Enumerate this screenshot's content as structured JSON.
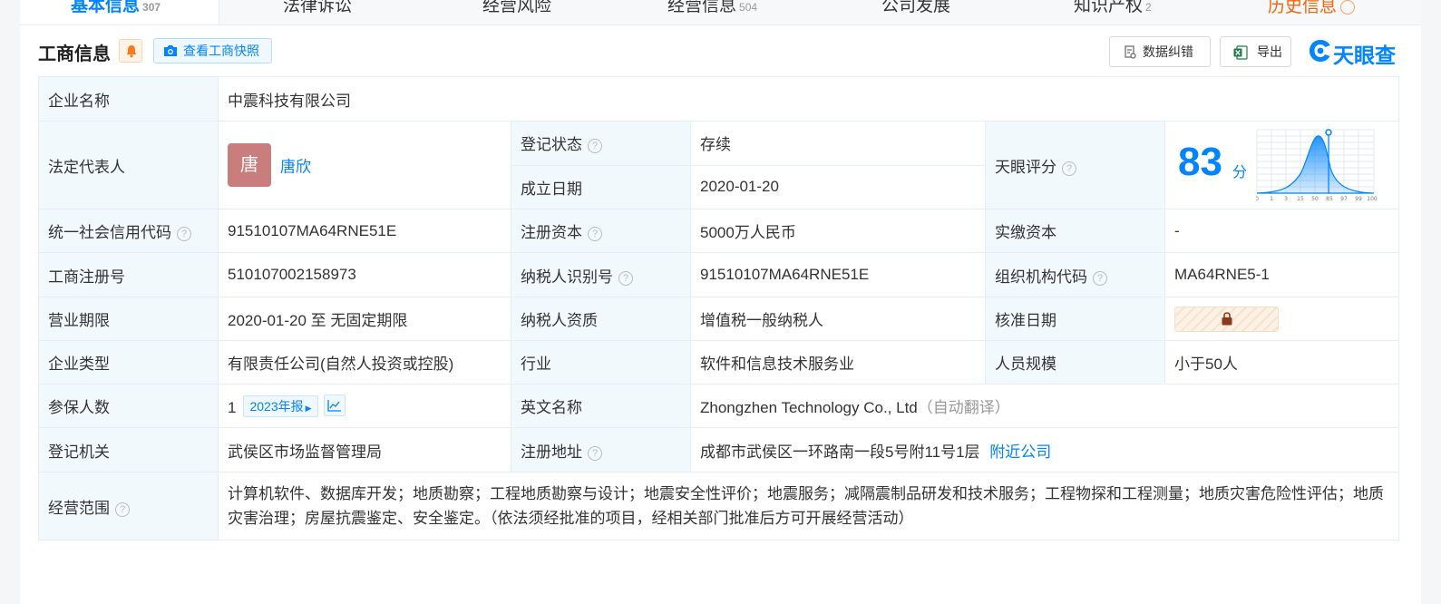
{
  "tabs": [
    {
      "label": "基本信息",
      "count": "307",
      "active": true
    },
    {
      "label": "法律诉讼",
      "count": ""
    },
    {
      "label": "经营风险",
      "count": ""
    },
    {
      "label": "经营信息",
      "count": "504"
    },
    {
      "label": "公司发展",
      "count": ""
    },
    {
      "label": "知识产权",
      "count": "2"
    },
    {
      "label": "历史信息",
      "count": ""
    }
  ],
  "header": {
    "title": "工商信息",
    "snapshot_label": "查看工商快照",
    "feedback_label": "数据纠错",
    "export_label": "导出",
    "logo_text": "天眼查"
  },
  "info": {
    "company_name_label": "企业名称",
    "company_name": "中震科技有限公司",
    "legal_rep_label": "法定代表人",
    "legal_rep_avatar": "唐",
    "legal_rep_name": "唐欣",
    "reg_status_label": "登记状态",
    "reg_status": "存续",
    "found_date_label": "成立日期",
    "found_date": "2020-01-20",
    "rating_label": "天眼评分",
    "rating_score": "83",
    "rating_unit": "分",
    "credit_code_label": "统一社会信用代码",
    "credit_code": "91510107MA64RNE51E",
    "reg_capital_label": "注册资本",
    "reg_capital": "5000万人民币",
    "paid_capital_label": "实缴资本",
    "paid_capital": "-",
    "reg_no_label": "工商注册号",
    "reg_no": "510107002158973",
    "taxpayer_id_label": "纳税人识别号",
    "taxpayer_id": "91510107MA64RNE51E",
    "org_code_label": "组织机构代码",
    "org_code": "MA64RNE5-1",
    "term_label": "营业期限",
    "term": "2020-01-20 至 无固定期限",
    "taxpayer_qual_label": "纳税人资质",
    "taxpayer_qual": "增值税一般纳税人",
    "approve_date_label": "核准日期",
    "type_label": "企业类型",
    "type": "有限责任公司(自然人投资或控股)",
    "industry_label": "行业",
    "industry": "软件和信息技术服务业",
    "staff_label": "人员规模",
    "staff": "小于50人",
    "insured_label": "参保人数",
    "insured": "1",
    "insured_report": "2023年报",
    "en_name_label": "英文名称",
    "en_name": "Zhongzhen Technology Co., Ltd",
    "en_name_note": "（自动翻译）",
    "authority_label": "登记机关",
    "authority": "武侯区市场监督管理局",
    "address_label": "注册地址",
    "address": "成都市武侯区一环路南一段5号附11号1层",
    "nearby_label": "附近公司",
    "scope_label": "经营范围",
    "scope": "计算机软件、数据库开发；地质勘察；工程地质勘察与设计；地震安全性评价；地震服务；减隔震制品研发和技术服务；工程物探和工程测量；地质灾害危险性评估；地质灾害治理；房屋抗震鉴定、安全鉴定。（依法须经批准的项目，经相关部门批准后方可开展经营活动）"
  },
  "rating_chart": {
    "ticks": [
      "0",
      "1",
      "3",
      "15",
      "50",
      "85",
      "97",
      "99",
      "100"
    ]
  },
  "colors": {
    "accent": "#0084ff",
    "status_green": "#00a84f",
    "label_bg": "#f2f9fc",
    "border": "#e4eef6"
  }
}
